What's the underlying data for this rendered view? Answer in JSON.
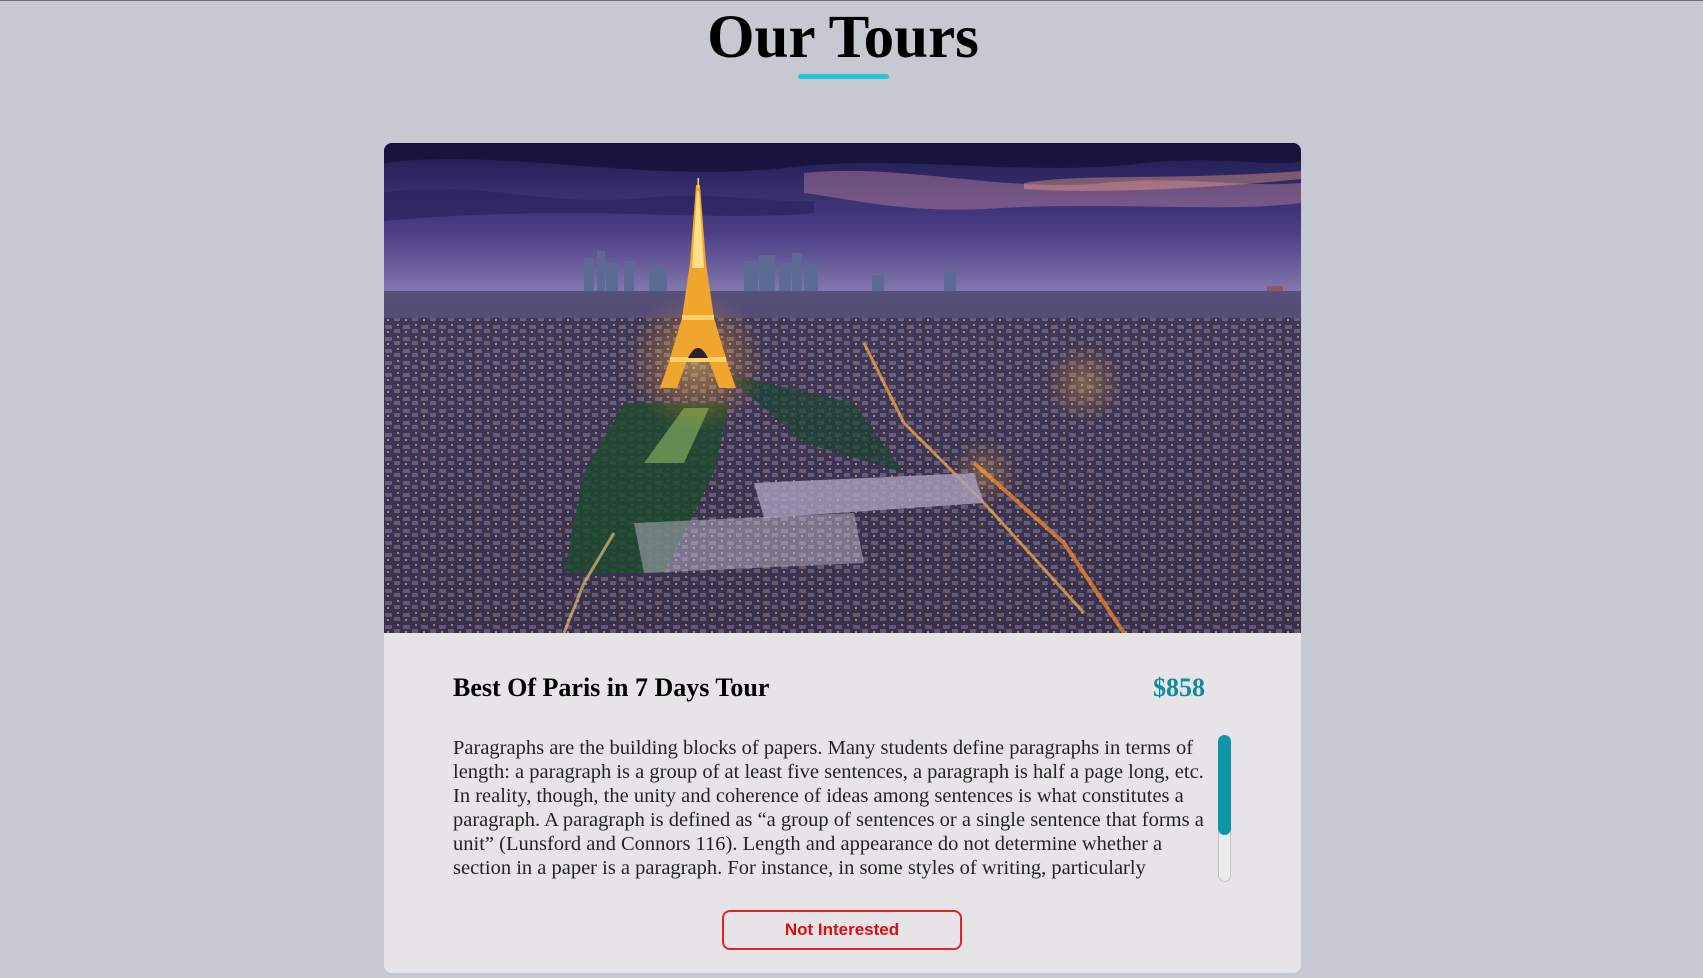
{
  "page": {
    "heading": "Our Tours"
  },
  "tour": {
    "name": "Best Of Paris in 7 Days Tour",
    "price": "$858",
    "image_subject": "Paris skyline at dusk with illuminated Eiffel Tower",
    "description": "Paragraphs are the building blocks of papers. Many students define paragraphs in terms of length: a paragraph is a group of at least five sentences, a paragraph is half a page long, etc. In reality, though, the unity and coherence of ideas among sentences is what constitutes a paragraph. A paragraph is defined as “a group of sentences or a single sentence that forms a unit” (Lunsford and Connors 116). Length and appearance do not determine whether a section in a paper is a paragraph. For instance, in some styles of writing, particularly",
    "button_label": "Not Interested"
  },
  "colors": {
    "background": "#c6c9d1",
    "accent": "#27c4d6",
    "price": "#0f8a9c",
    "card": "#e7e4e8",
    "danger": "#e02424"
  }
}
